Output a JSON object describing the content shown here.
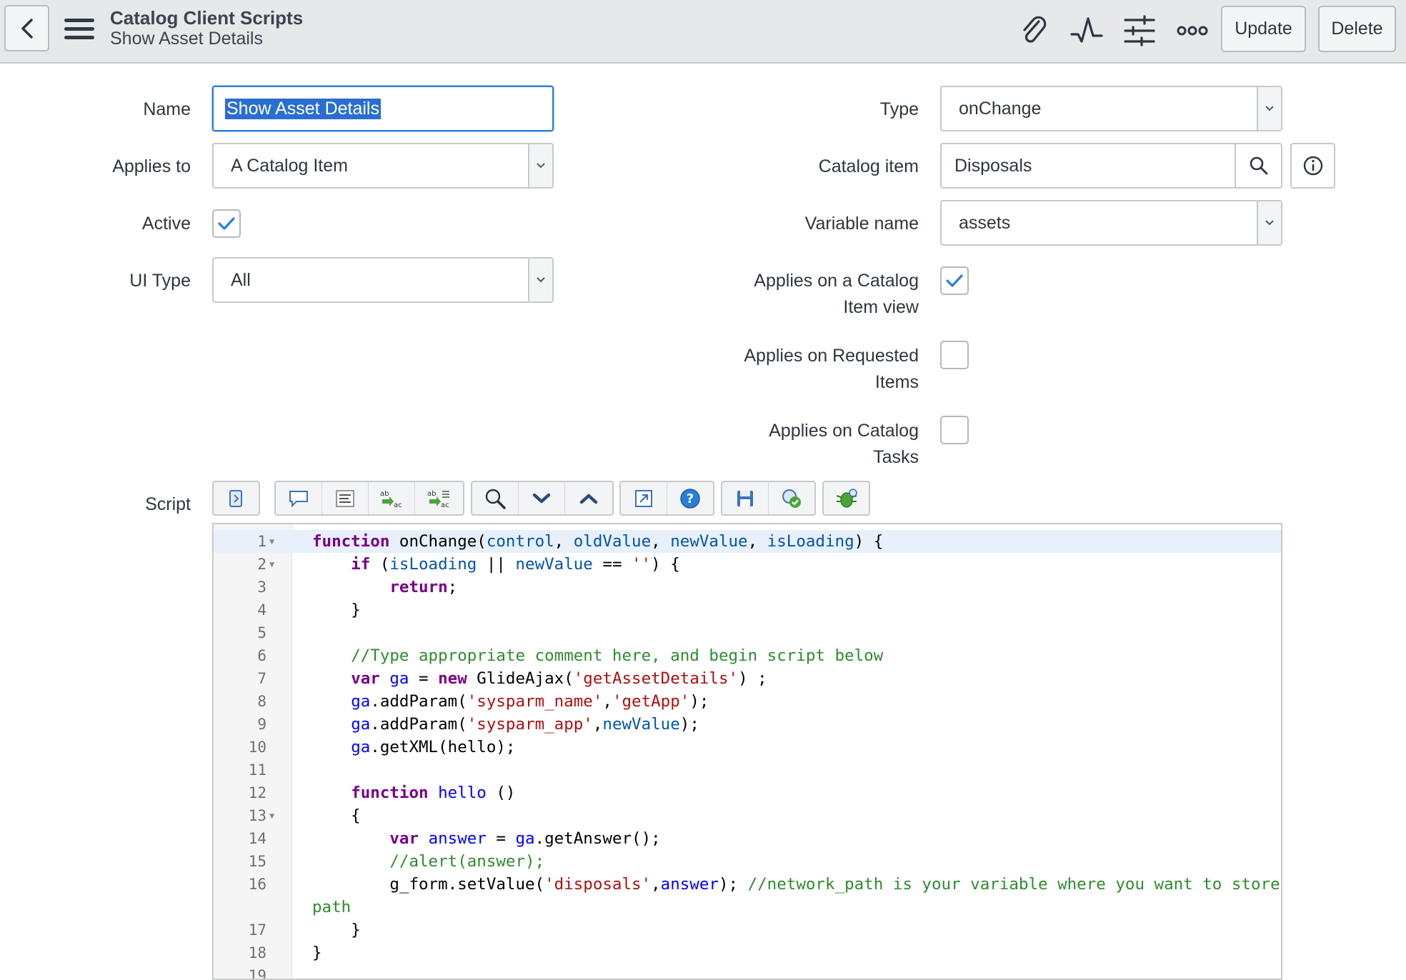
{
  "header": {
    "title": "Catalog Client Scripts",
    "subtitle": "Show Asset Details",
    "update_label": "Update",
    "delete_label": "Delete",
    "icons": [
      "back-icon",
      "menu-icon",
      "paperclip-icon",
      "activity-icon",
      "settings-sliders-icon",
      "more-icon"
    ]
  },
  "form": {
    "name_label": "Name",
    "name_value": "Show Asset Details",
    "applies_to_label": "Applies to",
    "applies_to_value": "A Catalog Item",
    "active_label": "Active",
    "active_checked": true,
    "ui_type_label": "UI Type",
    "ui_type_value": "All",
    "type_label": "Type",
    "type_value": "onChange",
    "catalog_item_label": "Catalog item",
    "catalog_item_value": "Disposals",
    "variable_name_label": "Variable name",
    "variable_name_value": "assets",
    "applies_catalog_view_label_1": "Applies on a Catalog",
    "applies_catalog_view_label_2": "Item view",
    "applies_catalog_view_checked": true,
    "applies_requested_label_1": "Applies on Requested",
    "applies_requested_label_2": "Items",
    "applies_requested_checked": false,
    "applies_tasks_label_1": "Applies on Catalog",
    "applies_tasks_label_2": "Tasks",
    "applies_tasks_checked": false,
    "script_label": "Script"
  },
  "colors": {
    "accent": "#2a7ed8",
    "keyword": "#770088",
    "variable": "#0000ff",
    "string": "#aa1111",
    "comment": "#2e8b2e"
  }
}
